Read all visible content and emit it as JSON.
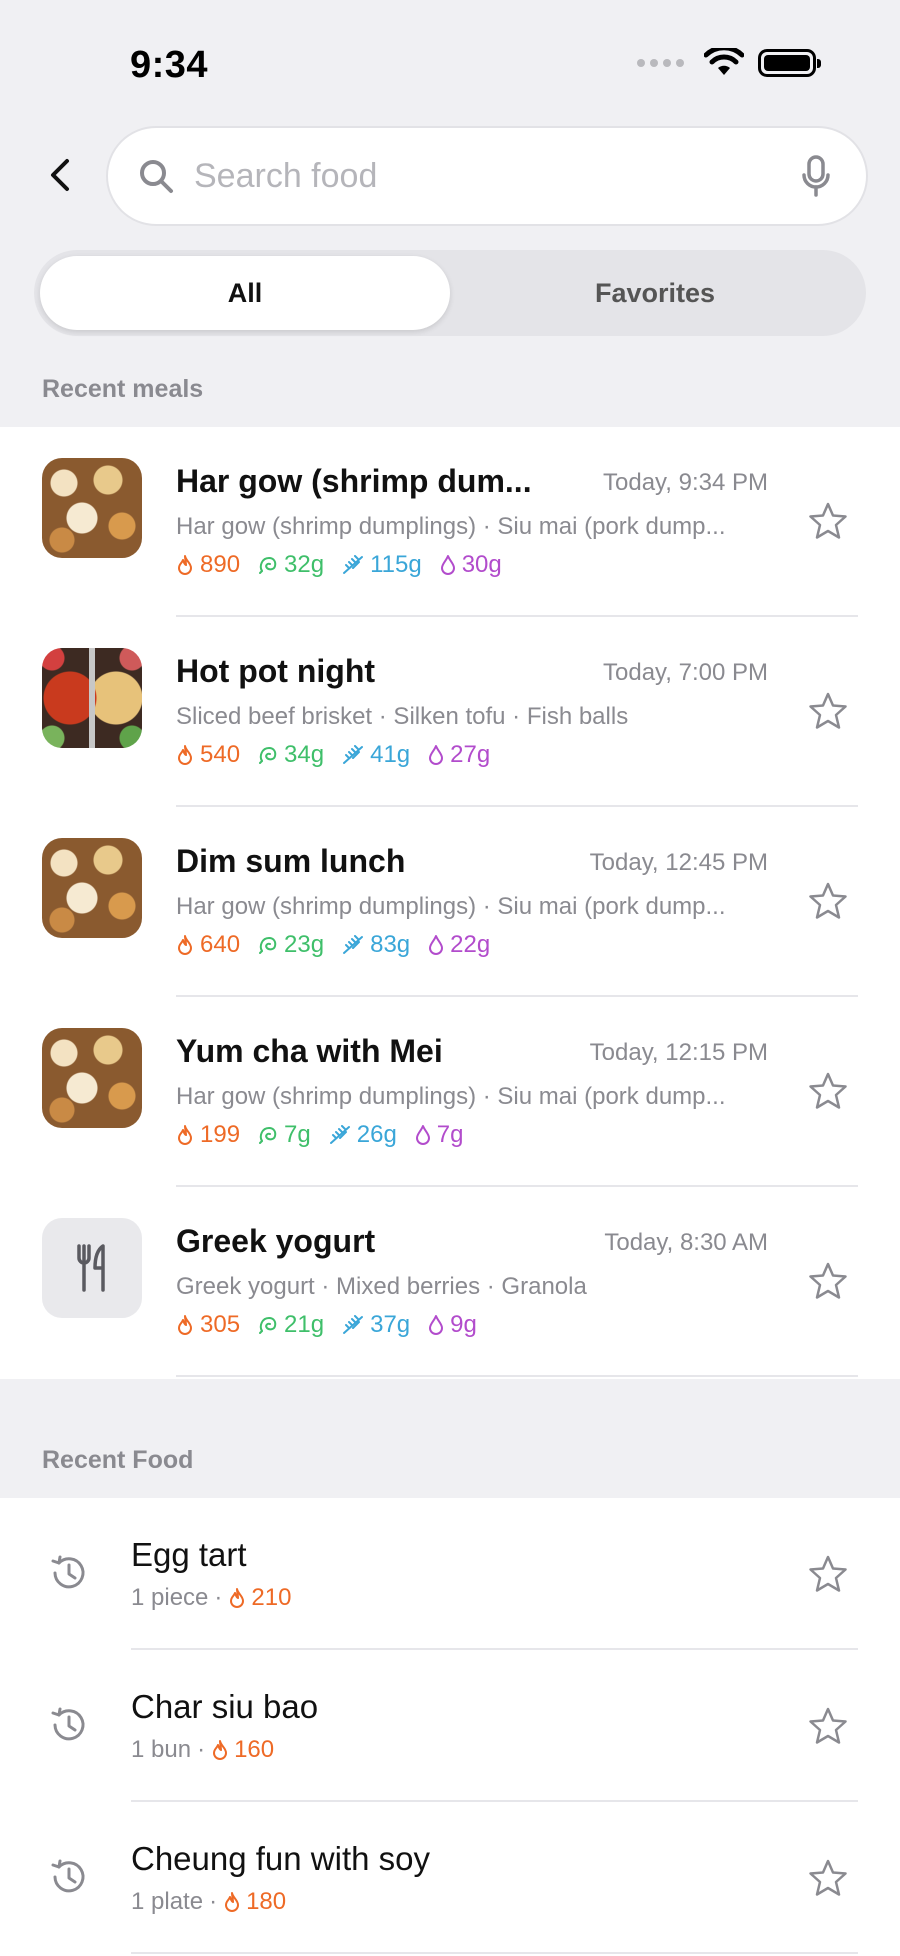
{
  "status_bar": {
    "time": "9:34"
  },
  "search": {
    "placeholder": "Search food"
  },
  "tabs": [
    {
      "label": "All",
      "active": true
    },
    {
      "label": "Favorites",
      "active": false
    }
  ],
  "sections": {
    "recent_meals": "Recent meals",
    "recent_food": "Recent Food"
  },
  "meals": [
    {
      "title": "Har gow (shrimp dum...",
      "time": "Today, 9:34 PM",
      "items": "Har gow (shrimp dumplings) · Siu mai (pork dump...",
      "kcal": "890",
      "protein": "32g",
      "carbs": "115g",
      "fat": "30g",
      "thumb": "dimsum-photo"
    },
    {
      "title": "Hot pot night",
      "time": "Today, 7:00 PM",
      "items": "Sliced beef brisket · Silken tofu · Fish balls",
      "kcal": "540",
      "protein": "34g",
      "carbs": "41g",
      "fat": "27g",
      "thumb": "hotpot-photo"
    },
    {
      "title": "Dim sum lunch",
      "time": "Today, 12:45 PM",
      "items": "Har gow (shrimp dumplings) · Siu mai (pork dump...",
      "kcal": "640",
      "protein": "23g",
      "carbs": "83g",
      "fat": "22g",
      "thumb": "dimsum-photo"
    },
    {
      "title": "Yum cha with Mei",
      "time": "Today, 12:15 PM",
      "items": "Har gow (shrimp dumplings) · Siu mai (pork dump...",
      "kcal": "199",
      "protein": "7g",
      "carbs": "26g",
      "fat": "7g",
      "thumb": "dimsum-photo"
    },
    {
      "title": "Greek yogurt",
      "time": "Today, 8:30 AM",
      "items": "Greek yogurt · Mixed berries · Granola",
      "kcal": "305",
      "protein": "21g",
      "carbs": "37g",
      "fat": "9g",
      "thumb": "fork-knife-icon"
    }
  ],
  "recent_food": [
    {
      "name": "Egg tart",
      "serving": "1 piece",
      "kcal": "210"
    },
    {
      "name": "Char siu bao",
      "serving": "1 bun",
      "kcal": "160"
    },
    {
      "name": "Cheung fun with soy",
      "serving": "1 plate",
      "kcal": "180"
    }
  ],
  "colors": {
    "kcal": "#ee6a26",
    "protein": "#3fbf6a",
    "carbs": "#3aa6d8",
    "fat": "#b24ccc"
  }
}
